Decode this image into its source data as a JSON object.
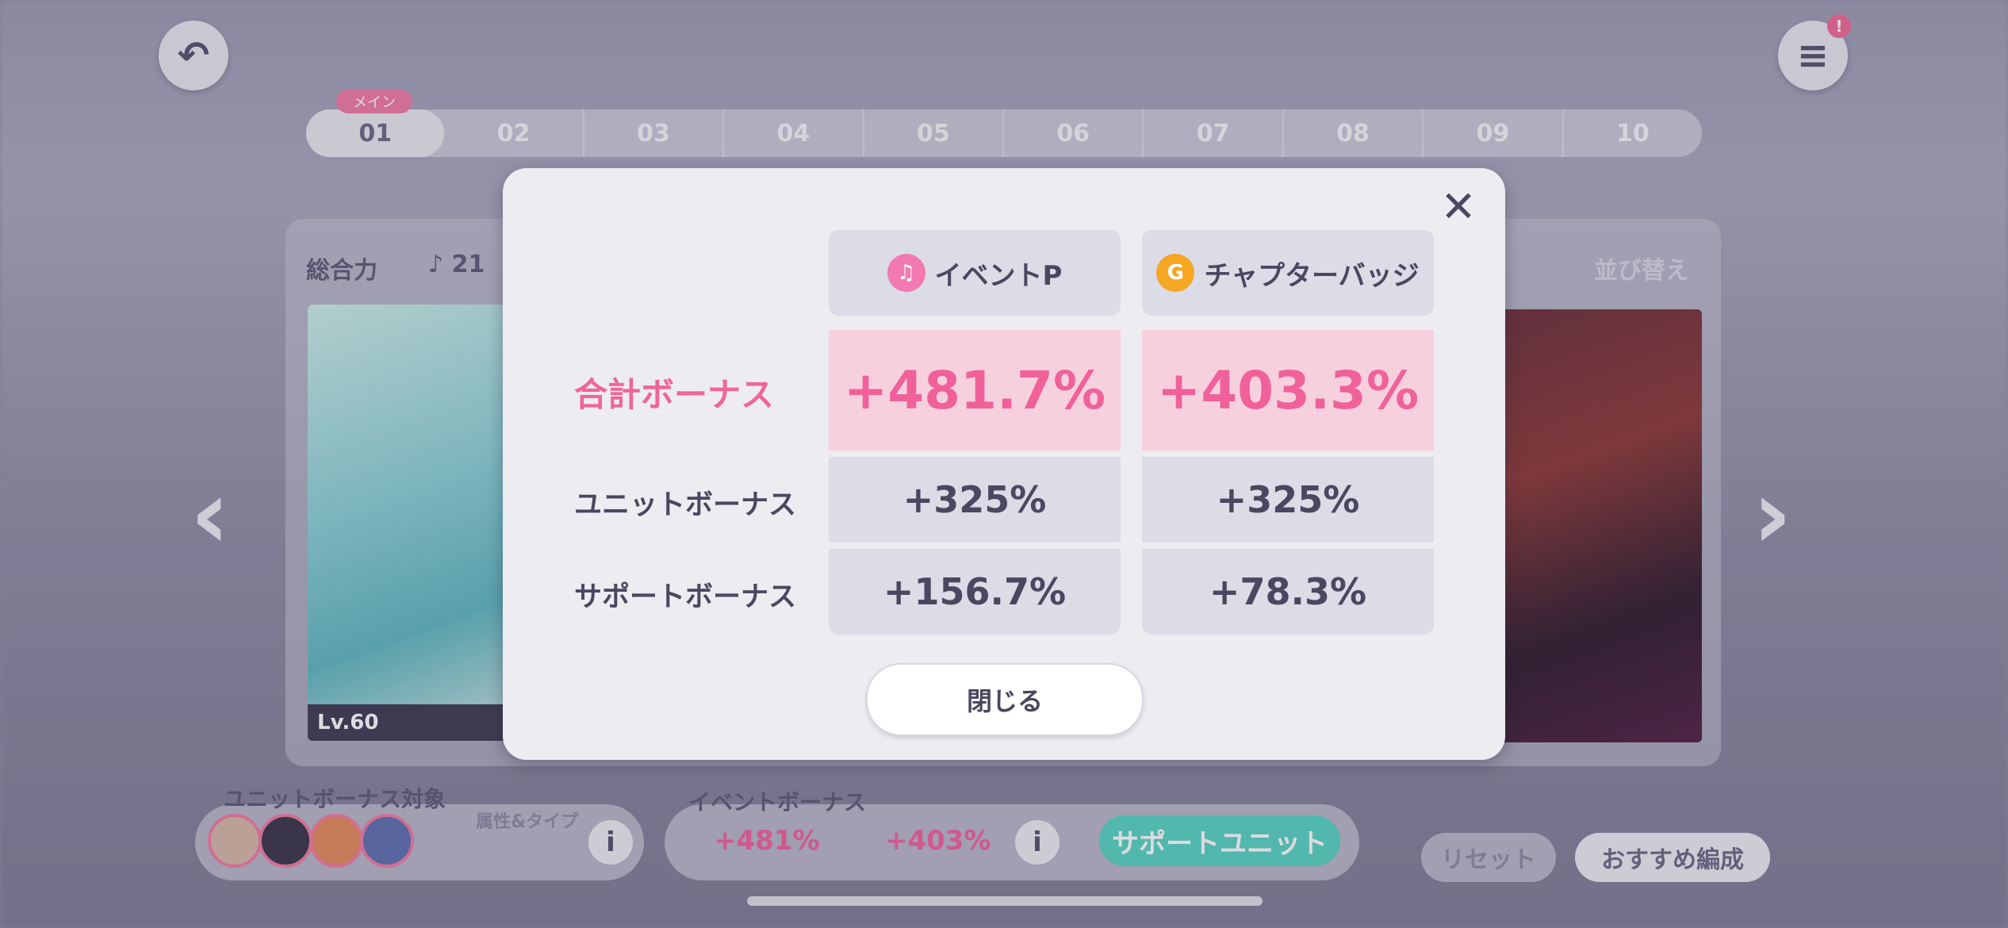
{
  "background": {
    "slots": [
      "01",
      "02",
      "03",
      "04",
      "05",
      "06",
      "07",
      "08",
      "09",
      "10"
    ],
    "main_tag": "メイン",
    "total_power_label": "総合力",
    "total_power_value": "21",
    "sort_label": "並び替え",
    "left_card_level": "Lv.60",
    "unit_bonus_target_label": "ユニットボーナス対象",
    "unit_type_label": "属性&タイプ",
    "event_bonus_label": "イベントボーナス",
    "event_bonus_p": "+481%",
    "event_bonus_badge": "+403%",
    "support_unit_label": "サポートユニット",
    "reset_label": "リセット",
    "recommend_label": "おすすめ編成",
    "notification_count": "!"
  },
  "modal": {
    "columns": [
      {
        "label": "イベントP",
        "icon": "event-point-icon",
        "color": "#f27ab0"
      },
      {
        "label": "チャプターバッジ",
        "icon": "chapter-badge-icon",
        "color": "#f5a623"
      }
    ],
    "rows": [
      {
        "label": "合計ボーナス",
        "values": [
          "+481.7%",
          "+403.3%"
        ]
      },
      {
        "label": "ユニットボーナス",
        "values": [
          "+325%",
          "+325%"
        ]
      },
      {
        "label": "サポートボーナス",
        "values": [
          "+156.7%",
          "+78.3%"
        ]
      }
    ],
    "close_button": "閉じる"
  },
  "colors": {
    "accent_pink": "#f0619a",
    "pink_cell": "#f7d0de",
    "cell_gray": "#dcdce6",
    "modal_bg": "#ececf1",
    "text_dark": "#4a4860"
  }
}
